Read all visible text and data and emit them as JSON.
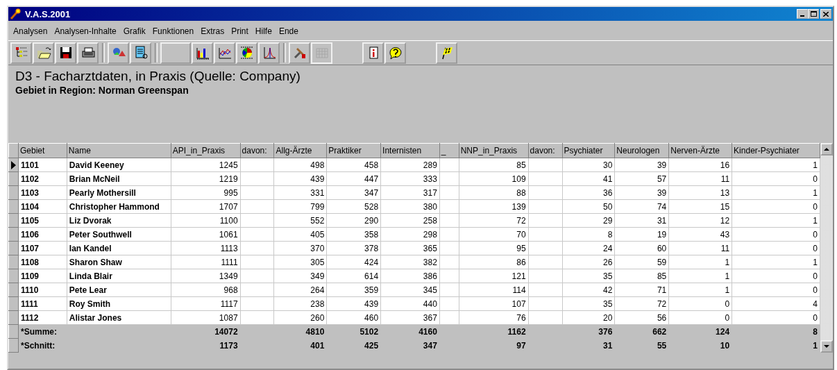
{
  "window": {
    "title": "V.A.S.2001"
  },
  "menu": [
    "Analysen",
    "Analysen-Inhalte",
    "Grafik",
    "Funktionen",
    "Extras",
    "Print",
    "Hilfe",
    "Ende"
  ],
  "toolbar": [
    {
      "kind": "tree",
      "disabled": false
    },
    {
      "kind": "open",
      "disabled": false
    },
    {
      "kind": "save",
      "disabled": false
    },
    {
      "kind": "print",
      "disabled": false
    },
    {
      "kind": "separator"
    },
    {
      "kind": "shapes",
      "disabled": false
    },
    {
      "kind": "document",
      "disabled": false
    },
    {
      "kind": "separator"
    },
    {
      "kind": "blank",
      "disabled": false
    },
    {
      "kind": "bars",
      "disabled": false
    },
    {
      "kind": "lines",
      "disabled": false
    },
    {
      "kind": "pie",
      "disabled": false
    },
    {
      "kind": "curve",
      "disabled": false
    },
    {
      "kind": "separator"
    },
    {
      "kind": "tools",
      "disabled": false
    },
    {
      "kind": "grid",
      "disabled": true
    },
    {
      "kind": "gap"
    },
    {
      "kind": "info",
      "disabled": false
    },
    {
      "kind": "help",
      "disabled": false
    },
    {
      "kind": "gap"
    },
    {
      "kind": "flag",
      "disabled": false
    }
  ],
  "report": {
    "title": "D3 - Facharztdaten, in Praxis (Quelle: Company)",
    "subtitle": "Gebiet in Region: Norman Greenspan"
  },
  "table": {
    "columns": [
      {
        "label": "Gebiet",
        "kind": "text"
      },
      {
        "label": "Name",
        "kind": "text"
      },
      {
        "label": "API_in_Praxis",
        "kind": "number"
      },
      {
        "label": "davon:",
        "kind": "spacer"
      },
      {
        "label": "Allg-Ärzte",
        "kind": "number"
      },
      {
        "label": "Praktiker",
        "kind": "number"
      },
      {
        "label": "Internisten",
        "kind": "number"
      },
      {
        "label": "_",
        "kind": "spacer"
      },
      {
        "label": "NNP_in_Praxis",
        "kind": "number"
      },
      {
        "label": "davon:",
        "kind": "spacer"
      },
      {
        "label": "Psychiater",
        "kind": "number"
      },
      {
        "label": "Neurologen",
        "kind": "number"
      },
      {
        "label": "Nerven-Ärzte",
        "kind": "number"
      },
      {
        "label": "Kinder-Psychiater",
        "kind": "number"
      }
    ],
    "rows": [
      {
        "kind": "data",
        "selected": true,
        "cells": [
          "1101",
          "David Keeney",
          "1245",
          "",
          "498",
          "458",
          "289",
          "",
          "85",
          "",
          "30",
          "39",
          "16",
          "1"
        ]
      },
      {
        "kind": "data",
        "selected": false,
        "cells": [
          "1102",
          "Brian McNeil",
          "1219",
          "",
          "439",
          "447",
          "333",
          "",
          "109",
          "",
          "41",
          "57",
          "11",
          "0"
        ]
      },
      {
        "kind": "data",
        "selected": false,
        "cells": [
          "1103",
          "Pearly Mothersill",
          "995",
          "",
          "331",
          "347",
          "317",
          "",
          "88",
          "",
          "36",
          "39",
          "13",
          "1"
        ]
      },
      {
        "kind": "data",
        "selected": false,
        "cells": [
          "1104",
          "Christopher Hammond",
          "1707",
          "",
          "799",
          "528",
          "380",
          "",
          "139",
          "",
          "50",
          "74",
          "15",
          "0"
        ]
      },
      {
        "kind": "data",
        "selected": false,
        "cells": [
          "1105",
          "Liz Dvorak",
          "1100",
          "",
          "552",
          "290",
          "258",
          "",
          "72",
          "",
          "29",
          "31",
          "12",
          "1"
        ]
      },
      {
        "kind": "data",
        "selected": false,
        "cells": [
          "1106",
          "Peter Southwell",
          "1061",
          "",
          "405",
          "358",
          "298",
          "",
          "70",
          "",
          "8",
          "19",
          "43",
          "0"
        ]
      },
      {
        "kind": "data",
        "selected": false,
        "cells": [
          "1107",
          "Ian Kandel",
          "1113",
          "",
          "370",
          "378",
          "365",
          "",
          "95",
          "",
          "24",
          "60",
          "11",
          "0"
        ]
      },
      {
        "kind": "data",
        "selected": false,
        "cells": [
          "1108",
          "Sharon Shaw",
          "1111",
          "",
          "305",
          "424",
          "382",
          "",
          "86",
          "",
          "26",
          "59",
          "1",
          "1"
        ]
      },
      {
        "kind": "data",
        "selected": false,
        "cells": [
          "1109",
          "Linda Blair",
          "1349",
          "",
          "349",
          "614",
          "386",
          "",
          "121",
          "",
          "35",
          "85",
          "1",
          "0"
        ]
      },
      {
        "kind": "data",
        "selected": false,
        "cells": [
          "1110",
          "Pete Lear",
          "968",
          "",
          "264",
          "359",
          "345",
          "",
          "114",
          "",
          "42",
          "71",
          "1",
          "0"
        ]
      },
      {
        "kind": "data",
        "selected": false,
        "cells": [
          "1111",
          "Roy Smith",
          "1117",
          "",
          "238",
          "439",
          "440",
          "",
          "107",
          "",
          "35",
          "72",
          "0",
          "4"
        ]
      },
      {
        "kind": "data",
        "selected": false,
        "cells": [
          "1112",
          "Alistar Jones",
          "1087",
          "",
          "260",
          "460",
          "367",
          "",
          "76",
          "",
          "20",
          "56",
          "0",
          "0"
        ]
      },
      {
        "kind": "total",
        "selected": false,
        "cells": [
          "*Summe:",
          "",
          "14072",
          "",
          "4810",
          "5102",
          "4160",
          "",
          "1162",
          "",
          "376",
          "662",
          "124",
          "8"
        ]
      },
      {
        "kind": "total",
        "selected": false,
        "cells": [
          "*Schnitt:",
          "",
          "1173",
          "",
          "401",
          "425",
          "347",
          "",
          "97",
          "",
          "31",
          "55",
          "10",
          "1"
        ]
      }
    ]
  }
}
